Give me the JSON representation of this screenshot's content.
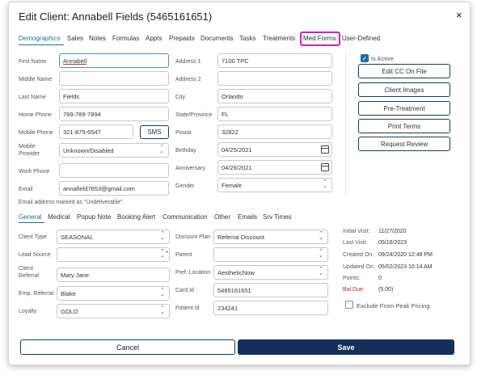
{
  "dialog": {
    "title": "Edit Client: Annabell Fields (5465161651)",
    "close_glyph": "×"
  },
  "tabs": [
    "Demographics",
    "Sales",
    "Notes",
    "Formulas",
    "Appts",
    "Prepaids",
    "Documents",
    "Tasks",
    "Treatments",
    "Med Forms",
    "User-Defined"
  ],
  "demographics": {
    "first_name_label": "First Name",
    "first_name": "Annabell",
    "middle_name_label": "Middle Name",
    "middle_name": "",
    "last_name_label": "Last Name",
    "last_name": "Fields",
    "home_phone_label": "Home Phone",
    "home_phone": "789-789-7894",
    "mobile_phone_label": "Mobile Phone",
    "mobile_phone": "321-875-6547",
    "sms_label": "SMS",
    "mobile_provider_label": "Mobile Provider",
    "mobile_provider": "Unknown/Disabled",
    "work_phone_label": "Work Phone",
    "work_phone": "",
    "email_label": "Email",
    "email": "annafield7653@gmail.com",
    "email_note": "Email address marked as \"Undeliverable\".",
    "address1_label": "Address 1",
    "address1": "7100 TPC",
    "address2_label": "Address 2",
    "address2": "",
    "city_label": "City",
    "city": "Orlando",
    "state_label": "State/Province",
    "state": "FL",
    "postal_label": "Postal",
    "postal": "32822",
    "birthday_label": "Birthday",
    "birthday": "04/25/2021",
    "anniversary_label": "Anniversary",
    "anniversary": "04/26/2021",
    "gender_label": "Gender",
    "gender": "Female"
  },
  "side_panel": {
    "is_active_label": "Is Active",
    "is_active": true,
    "buttons": [
      "Edit CC On File",
      "Client Images",
      "Pre-Treatment",
      "Print Terms",
      "Request Review"
    ]
  },
  "subtabs": [
    "General",
    "Medical",
    "Popup Note",
    "Booking Alert",
    "Communication",
    "Other",
    "Emails",
    "Srv Times"
  ],
  "general": {
    "client_type_label": "Client Type",
    "client_type": "SEASONAL",
    "lead_source_label": "Lead Source",
    "lead_source": "",
    "client_referral_label": "Client Referral",
    "client_referral": "Mary Jane",
    "emp_referral_label": "Emp. Referral",
    "emp_referral": "Blake",
    "loyalty_label": "Loyalty",
    "loyalty": "GOLD",
    "discount_plan_label": "Discount Plan",
    "discount_plan": "Referral Discount",
    "parent_label": "Parent",
    "parent": "",
    "pref_location_label": "Pref. Location",
    "pref_location": "AestheticNow",
    "card_id_label": "Card Id",
    "card_id": "5465161651",
    "patient_id_label": "Patient Id",
    "patient_id": "234241",
    "required_mark": "*"
  },
  "info": {
    "initial_visit_label": "Initial Visit:",
    "initial_visit": "11/27/2020",
    "last_visit_label": "Last Visit:",
    "last_visit": "05/16/2023",
    "created_on_label": "Created On:",
    "created_on": "09/24/2020 12:48 PM",
    "updated_on_label": "Updated On:",
    "updated_on": "05/02/2023 10:14 AM",
    "points_label": "Points:",
    "points": "0",
    "bal_due_label": "Bal Due:",
    "bal_due": "(5.00)",
    "exclude_label": "Exclude From Peak Pricing"
  },
  "footer": {
    "cancel_label": "Cancel",
    "save_label": "Save"
  },
  "colors": {
    "accent": "#1f6fa0",
    "save_bg": "#14305a",
    "highlight": "#d020c0",
    "bal_due": "#d02020"
  }
}
